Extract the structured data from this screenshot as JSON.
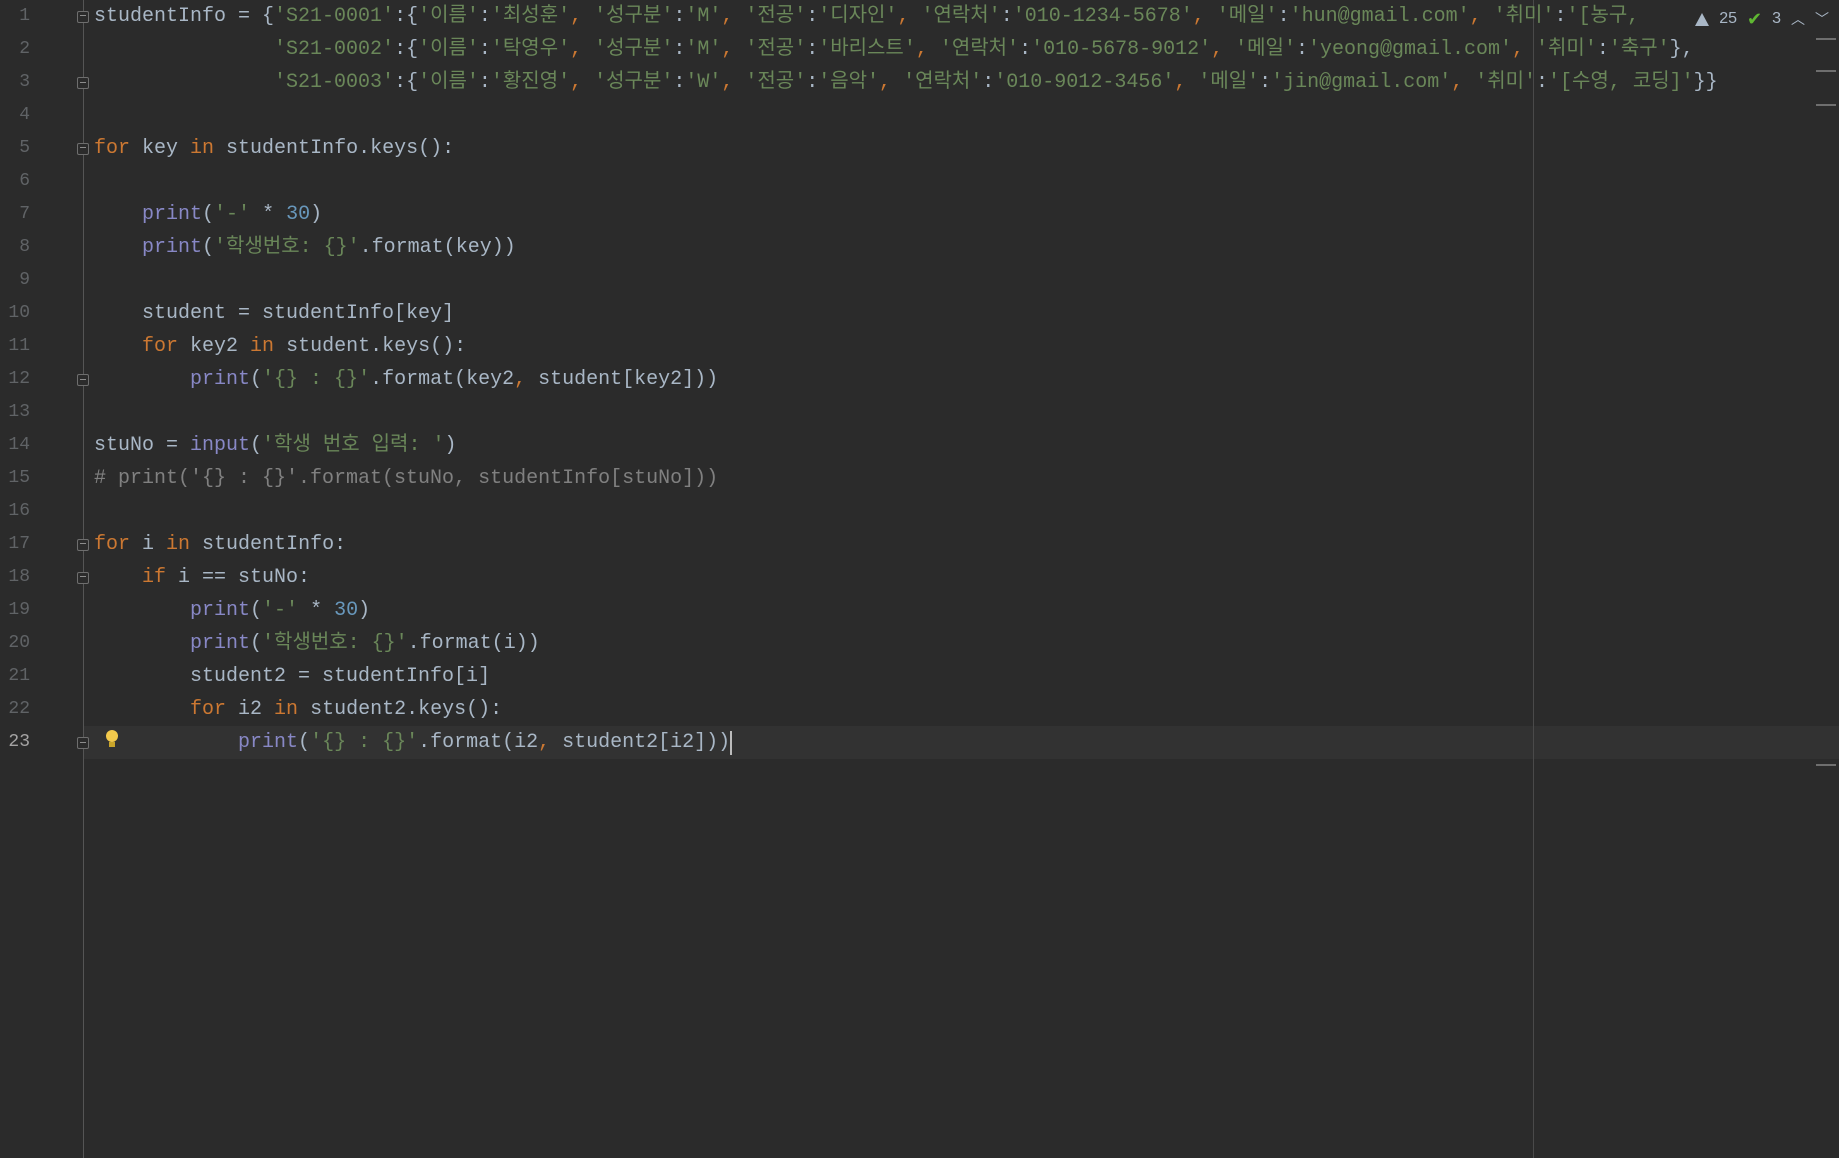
{
  "editor": {
    "lines": [
      {
        "n": "1",
        "tokens": [
          {
            "t": "studentInfo = {",
            "c": ""
          },
          {
            "t": "'S21-0001'",
            "c": "str"
          },
          {
            "t": ":{",
            "c": ""
          },
          {
            "t": "'이름'",
            "c": "str"
          },
          {
            "t": ":",
            "c": ""
          },
          {
            "t": "'최성훈'",
            "c": "str"
          },
          {
            "t": ", ",
            "c": "punc"
          },
          {
            "t": "'성구분'",
            "c": "str"
          },
          {
            "t": ":",
            "c": ""
          },
          {
            "t": "'M'",
            "c": "str"
          },
          {
            "t": ", ",
            "c": "punc"
          },
          {
            "t": "'전공'",
            "c": "str"
          },
          {
            "t": ":",
            "c": ""
          },
          {
            "t": "'디자인'",
            "c": "str"
          },
          {
            "t": ", ",
            "c": "punc"
          },
          {
            "t": "'연락처'",
            "c": "str"
          },
          {
            "t": ":",
            "c": ""
          },
          {
            "t": "'010-1234-5678'",
            "c": "str"
          },
          {
            "t": ", ",
            "c": "punc"
          },
          {
            "t": "'메일'",
            "c": "str"
          },
          {
            "t": ":",
            "c": ""
          },
          {
            "t": "'hun@gmail.com'",
            "c": "str"
          },
          {
            "t": ", ",
            "c": "punc"
          },
          {
            "t": "'취미'",
            "c": "str"
          },
          {
            "t": ":",
            "c": ""
          },
          {
            "t": "'[농구, ",
            "c": "str"
          }
        ]
      },
      {
        "n": "2",
        "tokens": [
          {
            "t": "               ",
            "c": ""
          },
          {
            "t": "'S21-0002'",
            "c": "str"
          },
          {
            "t": ":{",
            "c": ""
          },
          {
            "t": "'이름'",
            "c": "str"
          },
          {
            "t": ":",
            "c": ""
          },
          {
            "t": "'탁영우'",
            "c": "str"
          },
          {
            "t": ", ",
            "c": "punc"
          },
          {
            "t": "'성구분'",
            "c": "str"
          },
          {
            "t": ":",
            "c": ""
          },
          {
            "t": "'M'",
            "c": "str"
          },
          {
            "t": ", ",
            "c": "punc"
          },
          {
            "t": "'전공'",
            "c": "str"
          },
          {
            "t": ":",
            "c": ""
          },
          {
            "t": "'바리스트'",
            "c": "str"
          },
          {
            "t": ", ",
            "c": "punc"
          },
          {
            "t": "'연락처'",
            "c": "str"
          },
          {
            "t": ":",
            "c": ""
          },
          {
            "t": "'010-5678-9012'",
            "c": "str"
          },
          {
            "t": ", ",
            "c": "punc"
          },
          {
            "t": "'메일'",
            "c": "str"
          },
          {
            "t": ":",
            "c": ""
          },
          {
            "t": "'yeong@gmail.com'",
            "c": "str"
          },
          {
            "t": ", ",
            "c": "punc"
          },
          {
            "t": "'취미'",
            "c": "str"
          },
          {
            "t": ":",
            "c": ""
          },
          {
            "t": "'축구'",
            "c": "str"
          },
          {
            "t": "},",
            "c": ""
          }
        ]
      },
      {
        "n": "3",
        "tokens": [
          {
            "t": "               ",
            "c": ""
          },
          {
            "t": "'S21-0003'",
            "c": "str"
          },
          {
            "t": ":{",
            "c": ""
          },
          {
            "t": "'이름'",
            "c": "str"
          },
          {
            "t": ":",
            "c": ""
          },
          {
            "t": "'황진영'",
            "c": "str"
          },
          {
            "t": ", ",
            "c": "punc"
          },
          {
            "t": "'성구분'",
            "c": "str"
          },
          {
            "t": ":",
            "c": ""
          },
          {
            "t": "'W'",
            "c": "str"
          },
          {
            "t": ", ",
            "c": "punc"
          },
          {
            "t": "'전공'",
            "c": "str"
          },
          {
            "t": ":",
            "c": ""
          },
          {
            "t": "'음악'",
            "c": "str"
          },
          {
            "t": ", ",
            "c": "punc"
          },
          {
            "t": "'연락처'",
            "c": "str"
          },
          {
            "t": ":",
            "c": ""
          },
          {
            "t": "'010-9012-3456'",
            "c": "str"
          },
          {
            "t": ", ",
            "c": "punc"
          },
          {
            "t": "'메일'",
            "c": "str"
          },
          {
            "t": ":",
            "c": ""
          },
          {
            "t": "'jin@gmail.com'",
            "c": "str"
          },
          {
            "t": ", ",
            "c": "punc"
          },
          {
            "t": "'취미'",
            "c": "str"
          },
          {
            "t": ":",
            "c": ""
          },
          {
            "t": "'[수영, 코딩]'",
            "c": "str"
          },
          {
            "t": "}}",
            "c": ""
          }
        ]
      },
      {
        "n": "4",
        "tokens": []
      },
      {
        "n": "5",
        "tokens": [
          {
            "t": "for",
            "c": "kw"
          },
          {
            "t": " key ",
            "c": ""
          },
          {
            "t": "in",
            "c": "kw"
          },
          {
            "t": " studentInfo.keys():",
            "c": ""
          }
        ]
      },
      {
        "n": "6",
        "tokens": []
      },
      {
        "n": "7",
        "tokens": [
          {
            "t": "    ",
            "c": ""
          },
          {
            "t": "print",
            "c": "fn"
          },
          {
            "t": "(",
            "c": ""
          },
          {
            "t": "'-'",
            "c": "str"
          },
          {
            "t": " * ",
            "c": ""
          },
          {
            "t": "30",
            "c": "num"
          },
          {
            "t": ")",
            "c": ""
          }
        ]
      },
      {
        "n": "8",
        "tokens": [
          {
            "t": "    ",
            "c": ""
          },
          {
            "t": "print",
            "c": "fn"
          },
          {
            "t": "(",
            "c": ""
          },
          {
            "t": "'학생번호: {}'",
            "c": "str"
          },
          {
            "t": ".format(key))",
            "c": ""
          }
        ]
      },
      {
        "n": "9",
        "tokens": []
      },
      {
        "n": "10",
        "tokens": [
          {
            "t": "    student = studentInfo[key]",
            "c": ""
          }
        ]
      },
      {
        "n": "11",
        "tokens": [
          {
            "t": "    ",
            "c": ""
          },
          {
            "t": "for",
            "c": "kw"
          },
          {
            "t": " key2 ",
            "c": ""
          },
          {
            "t": "in",
            "c": "kw"
          },
          {
            "t": " student.keys():",
            "c": ""
          }
        ]
      },
      {
        "n": "12",
        "tokens": [
          {
            "t": "        ",
            "c": ""
          },
          {
            "t": "print",
            "c": "fn"
          },
          {
            "t": "(",
            "c": ""
          },
          {
            "t": "'{} : {}'",
            "c": "str"
          },
          {
            "t": ".format(key2",
            "c": ""
          },
          {
            "t": ", ",
            "c": "punc"
          },
          {
            "t": "student[key2]))",
            "c": ""
          }
        ]
      },
      {
        "n": "13",
        "tokens": []
      },
      {
        "n": "14",
        "tokens": [
          {
            "t": "stuNo = ",
            "c": ""
          },
          {
            "t": "input",
            "c": "fn"
          },
          {
            "t": "(",
            "c": ""
          },
          {
            "t": "'학생 번호 입력: '",
            "c": "str"
          },
          {
            "t": ")",
            "c": ""
          }
        ]
      },
      {
        "n": "15",
        "tokens": [
          {
            "t": "# print('{} : {}'.format(stuNo, studentInfo[stuNo]))",
            "c": "cm"
          }
        ]
      },
      {
        "n": "16",
        "tokens": []
      },
      {
        "n": "17",
        "tokens": [
          {
            "t": "for",
            "c": "kw"
          },
          {
            "t": " i ",
            "c": ""
          },
          {
            "t": "in",
            "c": "kw"
          },
          {
            "t": " studentInfo:",
            "c": ""
          }
        ]
      },
      {
        "n": "18",
        "tokens": [
          {
            "t": "    ",
            "c": ""
          },
          {
            "t": "if",
            "c": "kw"
          },
          {
            "t": " i == stuNo:",
            "c": ""
          }
        ]
      },
      {
        "n": "19",
        "tokens": [
          {
            "t": "        ",
            "c": ""
          },
          {
            "t": "print",
            "c": "fn"
          },
          {
            "t": "(",
            "c": ""
          },
          {
            "t": "'-'",
            "c": "str"
          },
          {
            "t": " * ",
            "c": ""
          },
          {
            "t": "30",
            "c": "num"
          },
          {
            "t": ")",
            "c": ""
          }
        ]
      },
      {
        "n": "20",
        "tokens": [
          {
            "t": "        ",
            "c": ""
          },
          {
            "t": "print",
            "c": "fn"
          },
          {
            "t": "(",
            "c": ""
          },
          {
            "t": "'학생번호: {}'",
            "c": "str"
          },
          {
            "t": ".format(i))",
            "c": ""
          }
        ]
      },
      {
        "n": "21",
        "tokens": [
          {
            "t": "        student2 = studentInfo[i]",
            "c": ""
          }
        ]
      },
      {
        "n": "22",
        "tokens": [
          {
            "t": "        ",
            "c": ""
          },
          {
            "t": "for",
            "c": "kw"
          },
          {
            "t": " i2 ",
            "c": ""
          },
          {
            "t": "in",
            "c": "kw"
          },
          {
            "t": " student2.keys():",
            "c": ""
          }
        ]
      },
      {
        "n": "23",
        "tokens": [
          {
            "t": "            ",
            "c": ""
          },
          {
            "t": "print",
            "c": "fn"
          },
          {
            "t": "(",
            "c": ""
          },
          {
            "t": "'{} : {}'",
            "c": "str"
          },
          {
            "t": ".format(i2",
            "c": ""
          },
          {
            "t": ", ",
            "c": "punc"
          },
          {
            "t": "student2[i2]))",
            "c": ""
          }
        ]
      }
    ]
  },
  "status": {
    "warnings": "25",
    "checks": "3",
    "warning_icon": "warning-icon",
    "check_icon": "check-icon"
  }
}
